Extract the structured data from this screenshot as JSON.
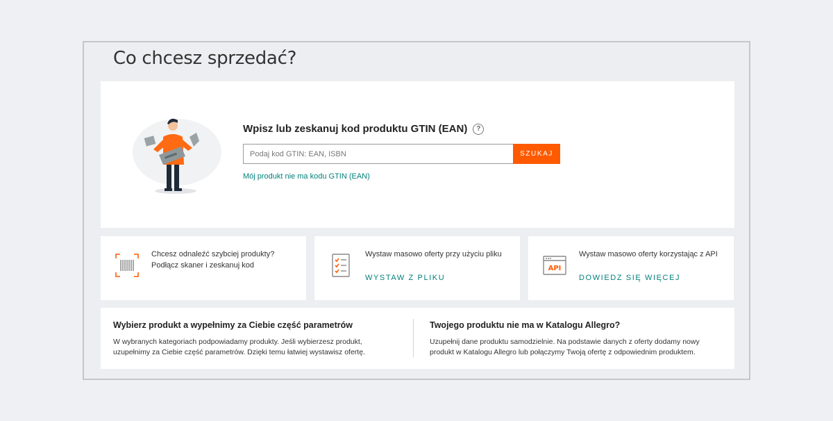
{
  "page": {
    "title": "Co chcesz sprzedać?"
  },
  "search": {
    "heading": "Wpisz lub zeskanuj kod produktu GTIN (EAN)",
    "help_icon": "question-circle-icon",
    "placeholder": "Podaj kod GTIN: EAN, ISBN",
    "value": "",
    "button_label": "SZUKAJ",
    "no_gtin_link": "Mój produkt nie ma kodu GTIN (EAN)"
  },
  "options": [
    {
      "icon": "barcode-scanner-icon",
      "text_line1": "Chcesz odnaleźć szybciej produkty?",
      "text_line2": "Podłącz skaner i zeskanuj kod",
      "link": ""
    },
    {
      "icon": "file-checklist-icon",
      "text_line1": "Wystaw masowo oferty przy użyciu pliku",
      "link": "WYSTAW Z PLIKU"
    },
    {
      "icon": "api-window-icon",
      "text_line1": "Wystaw masowo oferty korzystając z API",
      "link": "DOWIEDZ SIĘ WIĘCEJ"
    }
  ],
  "info": {
    "left": {
      "title": "Wybierz produkt a wypełnimy za Ciebie część parametrów",
      "line1": "W wybranych kategoriach podpowiadamy produkty. Jeśli wybierzesz produkt,",
      "line2": "uzupełnimy za Ciebie część parametrów. Dzięki temu łatwiej wystawisz ofertę."
    },
    "right": {
      "title": "Twojego produktu nie ma w Katalogu Allegro?",
      "line1": "Uzupełnij dane produktu samodzielnie. Na podstawie danych z oferty dodamy nowy",
      "line2": "produkt w Katalogu Allegro lub połączymy Twoją ofertę z odpowiednim produktem."
    }
  },
  "colors": {
    "accent": "#ff5a00",
    "link": "#00807b",
    "background": "#eef0f3"
  }
}
